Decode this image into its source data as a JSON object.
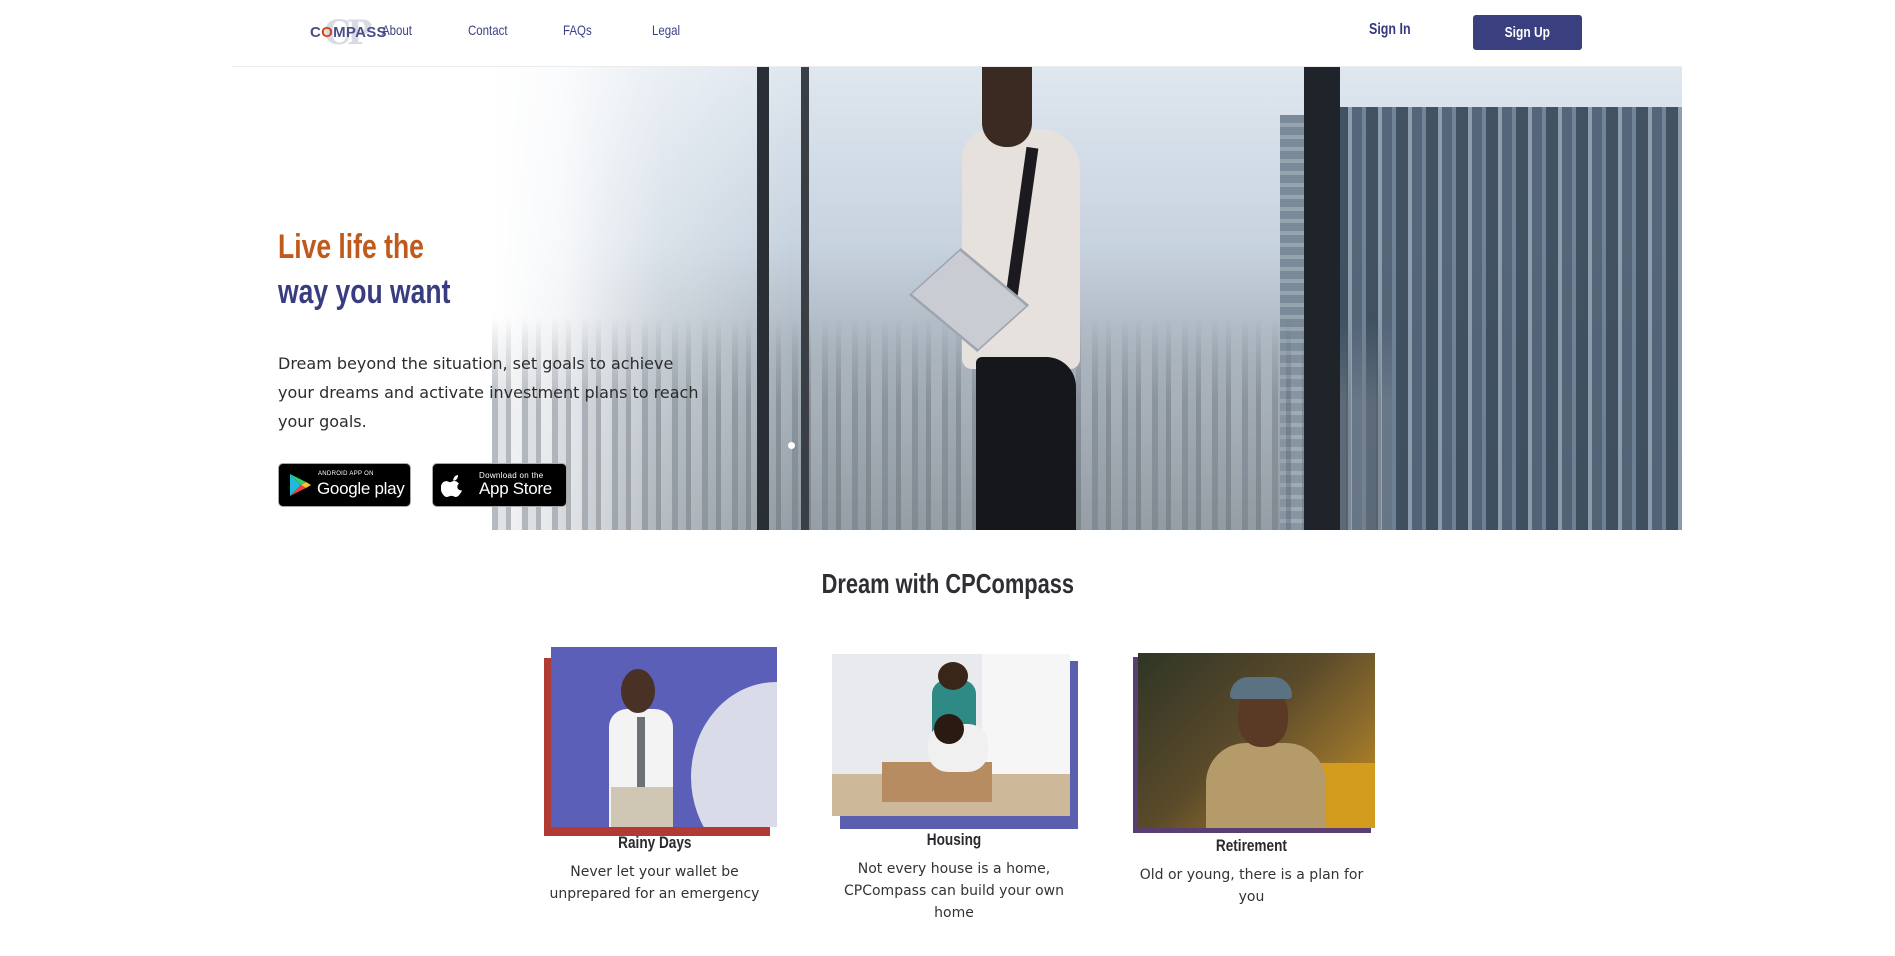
{
  "nav": {
    "logo_mark": "CP",
    "logo_text_start": "C",
    "logo_text_o": "O",
    "logo_text_end": "MPASS",
    "links": [
      "About",
      "Contact",
      "FAQs",
      "Legal"
    ],
    "sign_in": "Sign In",
    "sign_up": "Sign Up"
  },
  "hero": {
    "headline_line1": "Live life the",
    "headline_line2": "way you want",
    "body": "Dream beyond the situation, set goals to achieve your dreams and activate investment plans to reach your goals.",
    "google_play_small": "ANDROID APP ON",
    "google_play_big": "Google play",
    "app_store_small": "Download on the",
    "app_store_big": "App Store",
    "carousel_active_index": 1,
    "carousel_count": 1
  },
  "section": {
    "title": "Dream with CPCompass",
    "cards": [
      {
        "title": "Rainy Days",
        "description": "Never let your wallet be unprepared for an emergency",
        "icon": "man-on-phone-photo"
      },
      {
        "title": "Housing",
        "description": "Not every house is a home, CPCompass can build your own home",
        "icon": "couple-moving-photo"
      },
      {
        "title": "Retirement",
        "description": "Old or young, there is a plan for you",
        "icon": "older-man-photo"
      }
    ]
  },
  "colors": {
    "brand_navy": "#383d80",
    "brand_orange": "#c05a1c",
    "card1_accent": "#b23a35",
    "card2_accent": "#5a5fae",
    "card3_accent": "#5a3e72"
  }
}
